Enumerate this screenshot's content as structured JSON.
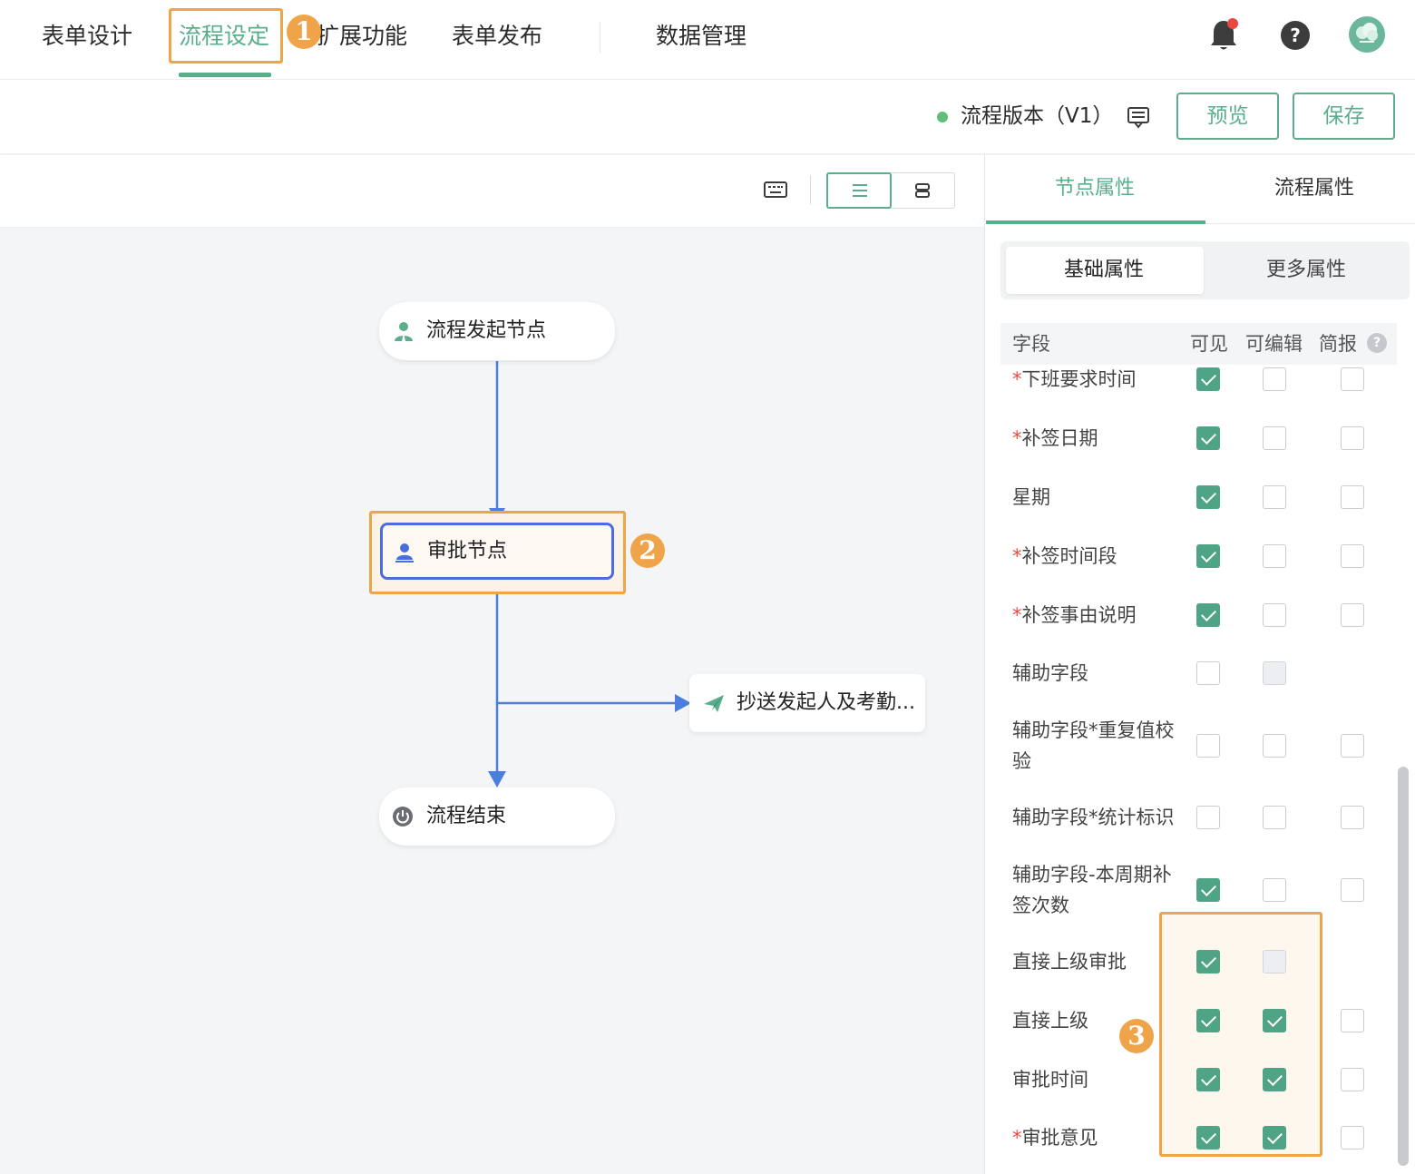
{
  "nav": {
    "tabs": [
      "表单设计",
      "流程设定",
      "扩展功能",
      "表单发布",
      "数据管理"
    ],
    "active_tab": "流程设定"
  },
  "annotations": {
    "badge1": "1",
    "badge2": "2",
    "badge3": "3"
  },
  "version": {
    "label": "流程版本（V1）",
    "status_color": "#5fbf78"
  },
  "buttons": {
    "preview": "预览",
    "save": "保存"
  },
  "flow": {
    "start": "流程发起节点",
    "approve": "审批节点",
    "cc": "抄送发起人及考勤...",
    "end": "流程结束"
  },
  "panel": {
    "tabs": [
      "节点属性",
      "流程属性"
    ],
    "subtabs": [
      "基础属性",
      "更多属性"
    ],
    "headers": {
      "field": "字段",
      "visible": "可见",
      "editable": "可编辑",
      "brief": "简报"
    },
    "rows": [
      {
        "label": "下班要求时间",
        "required": true,
        "visible": "on",
        "editable": "off",
        "brief": "off"
      },
      {
        "label": "补签日期",
        "required": true,
        "visible": "on",
        "editable": "off",
        "brief": "off"
      },
      {
        "label": "星期",
        "required": false,
        "visible": "on",
        "editable": "off",
        "brief": "off"
      },
      {
        "label": "补签时间段",
        "required": true,
        "visible": "on",
        "editable": "off",
        "brief": "off"
      },
      {
        "label": "补签事由说明",
        "required": true,
        "visible": "on",
        "editable": "off",
        "brief": "off"
      },
      {
        "label": "辅助字段",
        "required": false,
        "visible": "off",
        "editable": "disabled",
        "brief": "none"
      },
      {
        "label": "辅助字段*重复值校验",
        "required": false,
        "visible": "off",
        "editable": "off",
        "brief": "off"
      },
      {
        "label": "辅助字段*统计标识",
        "required": false,
        "visible": "off",
        "editable": "off",
        "brief": "off"
      },
      {
        "label": "辅助字段-本周期补签次数",
        "required": false,
        "visible": "on",
        "editable": "off",
        "brief": "off"
      },
      {
        "label": "直接上级审批",
        "required": false,
        "visible": "on",
        "editable": "disabled",
        "brief": "none"
      },
      {
        "label": "直接上级",
        "required": false,
        "visible": "on",
        "editable": "on",
        "brief": "off"
      },
      {
        "label": "审批时间",
        "required": false,
        "visible": "on",
        "editable": "on",
        "brief": "off"
      },
      {
        "label": "审批意见",
        "required": true,
        "visible": "on",
        "editable": "on",
        "brief": "off"
      }
    ]
  },
  "colors": {
    "accent": "#5aae8c",
    "highlight": "#f0a44a",
    "flow_line": "#4a7fe0",
    "required": "#e8483f"
  },
  "icons": [
    "bell-icon",
    "help-icon",
    "avatar",
    "message-icon",
    "keyboard-icon",
    "list-view-icon",
    "card-view-icon",
    "user-icon",
    "approver-icon",
    "send-icon",
    "power-icon",
    "question-icon",
    "check-icon"
  ]
}
